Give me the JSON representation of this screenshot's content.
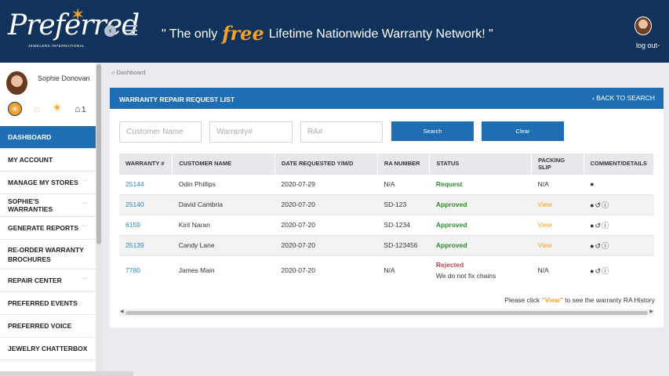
{
  "header": {
    "logo_script": "Preferred",
    "logo_tag": "JEWELERS INTERNATIONAL",
    "slogan_pre": "\" The only",
    "slogan_free": "free",
    "slogan_post": "Lifetime Nationwide Warranty Network! \"",
    "logout": "log out-"
  },
  "sidebar": {
    "user_name": "Sophie Donovan",
    "home_count": "1",
    "items": [
      {
        "label": "DASHBOARD"
      },
      {
        "label": "MY ACCOUNT"
      },
      {
        "label": "MANAGE MY STORES"
      },
      {
        "label": "SOPHIE'S WARRANTIES"
      },
      {
        "label": "GENERATE REPORTS"
      },
      {
        "label": "RE-ORDER WARRANTY BROCHURES"
      },
      {
        "label": "REPAIR CENTER"
      },
      {
        "label": "PREFERRED EVENTS"
      },
      {
        "label": "PREFERRED VOICE"
      },
      {
        "label": "JEWELRY CHATTERBOX"
      }
    ]
  },
  "breadcrumb": "Dashboard",
  "panel": {
    "title": "WARRANTY REPAIR REQUEST LIST",
    "back": "BACK TO SEARCH"
  },
  "search": {
    "customer_placeholder": "Customer Name",
    "warranty_placeholder": "Warranty#",
    "ra_placeholder": "RA#",
    "search_label": "Search",
    "clear_label": "Clear"
  },
  "table": {
    "headers": [
      "WARRANTY #",
      "CUSTOMER NAME",
      "DATE REQUESTED Y/M/D",
      "RA NUMBER",
      "STATUS",
      "PACKING SLIP",
      "COMMENT/DETAILS"
    ],
    "rows": [
      {
        "warranty": "25144",
        "customer": "Odin Phillips",
        "date": "2020-07-29",
        "ra": "N/A",
        "status": "Request",
        "note": "",
        "slip": "N/A"
      },
      {
        "warranty": "25140",
        "customer": "David Cambria",
        "date": "2020-07-20",
        "ra": "SD-123",
        "status": "Approved",
        "note": "",
        "slip": "View"
      },
      {
        "warranty": "6159",
        "customer": "Kirit Naran",
        "date": "2020-07-20",
        "ra": "SD-1234",
        "status": "Approved",
        "note": "",
        "slip": "View"
      },
      {
        "warranty": "25139",
        "customer": "Candy Lane",
        "date": "2020-07-20",
        "ra": "SD-123456",
        "status": "Approved",
        "note": "",
        "slip": "View"
      },
      {
        "warranty": "7780",
        "customer": "James Main",
        "date": "2020-07-20",
        "ra": "N/A",
        "status": "Rejected",
        "note": "We do not fix chains",
        "slip": "N/A"
      }
    ]
  },
  "footnote": {
    "pre": "Please click",
    "view": "\"View\"",
    "post": "to see the warranty RA History"
  },
  "colors": {
    "navy": "#11335b",
    "blue": "#1f6eb3",
    "orange": "#f4a12b",
    "green": "#2c8a2c",
    "red": "#b54a4a"
  }
}
